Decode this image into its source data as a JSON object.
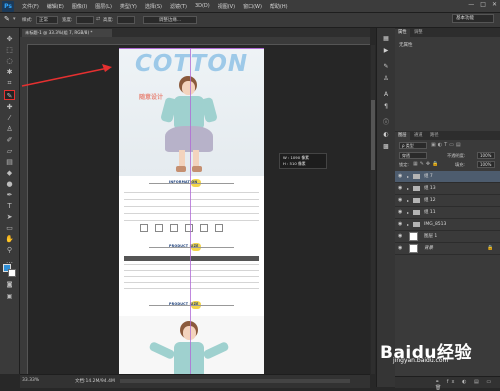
{
  "app": {
    "logo": "Ps"
  },
  "menubar": {
    "items": [
      "文件(F)",
      "编辑(E)",
      "图像(I)",
      "图层(L)",
      "类型(Y)",
      "选择(S)",
      "滤镜(T)",
      "3D(D)",
      "视图(V)",
      "窗口(W)",
      "帮助(H)"
    ],
    "window_buttons": [
      "—",
      "□",
      "✕"
    ]
  },
  "options_bar": {
    "style_label": "样式:",
    "style_value": "正常",
    "width_label": "宽度:",
    "height_label": "高度:",
    "refine_edge": "调整边缘...",
    "workspace": "基本功能"
  },
  "document": {
    "tab_title": "未标题-1 @ 33.3%(组 7, RGB/8) *",
    "hero_text": "COTTON",
    "hero_subtitle": "随意设计",
    "section_info": "INFORMATION",
    "section_product_size": "PRODUCT SIZE",
    "section_product_size_2": "PRODUCT SIZE"
  },
  "tooltip": {
    "w_line": "W :  1090 像素",
    "h_line": "H :   510 像素"
  },
  "status": {
    "zoom": "33.33%",
    "doc_info": "文档:14.2M/94.4M"
  },
  "panels": {
    "top_tabs": [
      "属性",
      "调整"
    ],
    "properties_empty": "无属性",
    "layers_tabs": [
      "图层",
      "通道",
      "路径"
    ],
    "kind_label": "ρ 类型",
    "blend_mode": "穿透",
    "opacity_label": "不透明度:",
    "opacity_value": "100%",
    "lock_label": "锁定:",
    "fill_label": "填充:",
    "fill_value": "100%",
    "layers": [
      {
        "name": "组 7",
        "type": "group",
        "selected": true
      },
      {
        "name": "组 13",
        "type": "group"
      },
      {
        "name": "组 12",
        "type": "group"
      },
      {
        "name": "组 11",
        "type": "group"
      },
      {
        "name": "IMG_8513",
        "type": "layer"
      },
      {
        "name": "图层 1",
        "type": "layer"
      },
      {
        "name": "背景",
        "type": "background"
      }
    ]
  },
  "watermark": {
    "text": "Baidu经验",
    "url": "jingyan.baidu.com"
  },
  "colors": {
    "accent_red": "#e53030",
    "foreground": "#2f8fd6",
    "background": "#ffffff",
    "guide": "#b06ad6"
  }
}
